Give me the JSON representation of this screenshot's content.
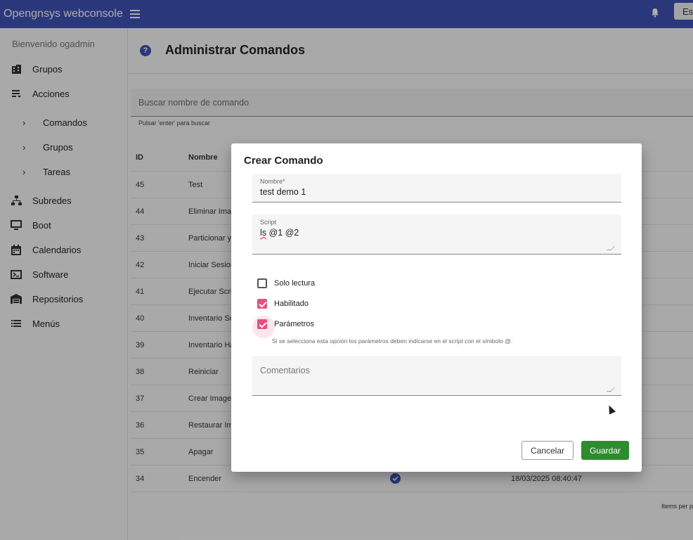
{
  "topbar": {
    "app_title": "Opengnsys webconsole",
    "button_label": "Es"
  },
  "sidebar": {
    "welcome": "Bienvenido ogadmin",
    "items": [
      {
        "label": "Grupos",
        "icon": "building-icon"
      },
      {
        "label": "Acciones",
        "icon": "list-icon"
      },
      {
        "label": "Comandos",
        "icon": "chevron-right-icon"
      },
      {
        "label": "Grupos",
        "icon": "chevron-right-icon"
      },
      {
        "label": "Tareas",
        "icon": "chevron-right-icon"
      },
      {
        "label": "Subredes",
        "icon": "network-icon"
      },
      {
        "label": "Boot",
        "icon": "monitor-icon"
      },
      {
        "label": "Calendarios",
        "icon": "calendar-icon"
      },
      {
        "label": "Software",
        "icon": "terminal-icon"
      },
      {
        "label": "Repositorios",
        "icon": "warehouse-icon"
      },
      {
        "label": "Menús",
        "icon": "menu-list-icon"
      }
    ]
  },
  "main": {
    "title": "Administrar Comandos",
    "search_placeholder": "Buscar nombre de comando",
    "search_hint": "Pulsar 'enter' para buscar",
    "table": {
      "headers": {
        "id": "ID",
        "name": "Nombre"
      },
      "rows": [
        {
          "id": "45",
          "name": "Test"
        },
        {
          "id": "44",
          "name": "Eliminar Imag"
        },
        {
          "id": "43",
          "name": "Particionar y"
        },
        {
          "id": "42",
          "name": "Iniciar Sesion"
        },
        {
          "id": "41",
          "name": "Ejecutar Scrip"
        },
        {
          "id": "40",
          "name": "Inventario So"
        },
        {
          "id": "39",
          "name": "Inventario Ha"
        },
        {
          "id": "38",
          "name": "Reiniciar"
        },
        {
          "id": "37",
          "name": "Crear Imagen"
        },
        {
          "id": "36",
          "name": "Restaurar Im"
        },
        {
          "id": "35",
          "name": "Apagar"
        },
        {
          "id": "34",
          "name": "Encender",
          "date": "18/03/2025 08:40:47"
        }
      ]
    },
    "items_per_page": "Items per p"
  },
  "dialog": {
    "title": "Crear Comando",
    "name_label": "Nombre*",
    "name_value": "test demo 1",
    "script_label": "Script",
    "script_value_first": "ls",
    "script_value_rest": " @1 @2",
    "checkboxes": [
      {
        "label": "Solo lectura",
        "checked": false
      },
      {
        "label": "Habilitado",
        "checked": true
      },
      {
        "label": "Parámetros",
        "checked": true
      }
    ],
    "params_hint": "Si se selecciona esta opción los parámetros deben indicarse en el script con el símbolo @.",
    "comments_placeholder": "Comentarios",
    "cancel_label": "Cancelar",
    "save_label": "Guardar"
  },
  "colors": {
    "primary": "#3f51b5",
    "accent": "#e94e7e",
    "save": "#2e8b2e"
  }
}
